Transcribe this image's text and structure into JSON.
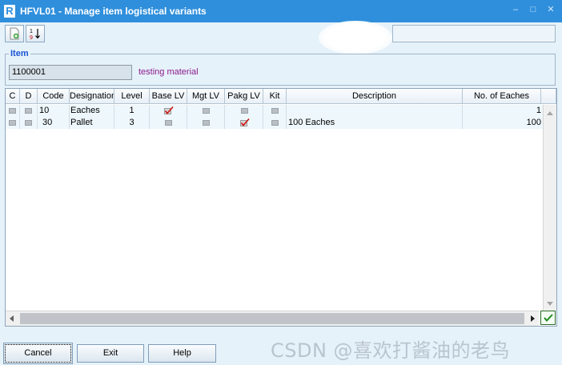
{
  "window": {
    "logo": "R",
    "title": "HFVL01 - Manage item logistical variants",
    "controls": [
      "minimize-icon",
      "maximize-icon",
      "close-icon"
    ]
  },
  "toolbar": {
    "buttons": [
      {
        "icon": "new-document-icon"
      },
      {
        "icon": "sort-numeric-icon",
        "glyph_top": "1",
        "glyph_bottom": "9"
      }
    ]
  },
  "item": {
    "legend": "Item",
    "code": "1100001",
    "description": "testing material"
  },
  "grid": {
    "columns": [
      "C",
      "D",
      "Code",
      "Designation",
      "Level",
      "Base LV",
      "Mgt LV",
      "Pakg LV",
      "Kit",
      "Description",
      "No. of Eaches"
    ],
    "rows": [
      {
        "c": false,
        "d": false,
        "code": "10",
        "designation": "Eaches",
        "level": "1",
        "base_lv": true,
        "mgt_lv": false,
        "pakg_lv": false,
        "kit": false,
        "description": "",
        "no_of_eaches": "1"
      },
      {
        "c": false,
        "d": false,
        "code": "30",
        "designation": "Pallet",
        "level": "3",
        "base_lv": false,
        "mgt_lv": false,
        "pakg_lv": true,
        "kit": false,
        "description": "100 Eaches",
        "no_of_eaches": "100"
      }
    ]
  },
  "buttons": {
    "cancel": "Cancel",
    "exit": "Exit",
    "help": "Help"
  },
  "watermark": "CSDN @喜欢打酱油的老鸟",
  "colors": {
    "titlebar": "#2f8fdc",
    "legend": "#1b55d6",
    "item_description": "#8a1a8a",
    "check_mark": "#d01010"
  }
}
